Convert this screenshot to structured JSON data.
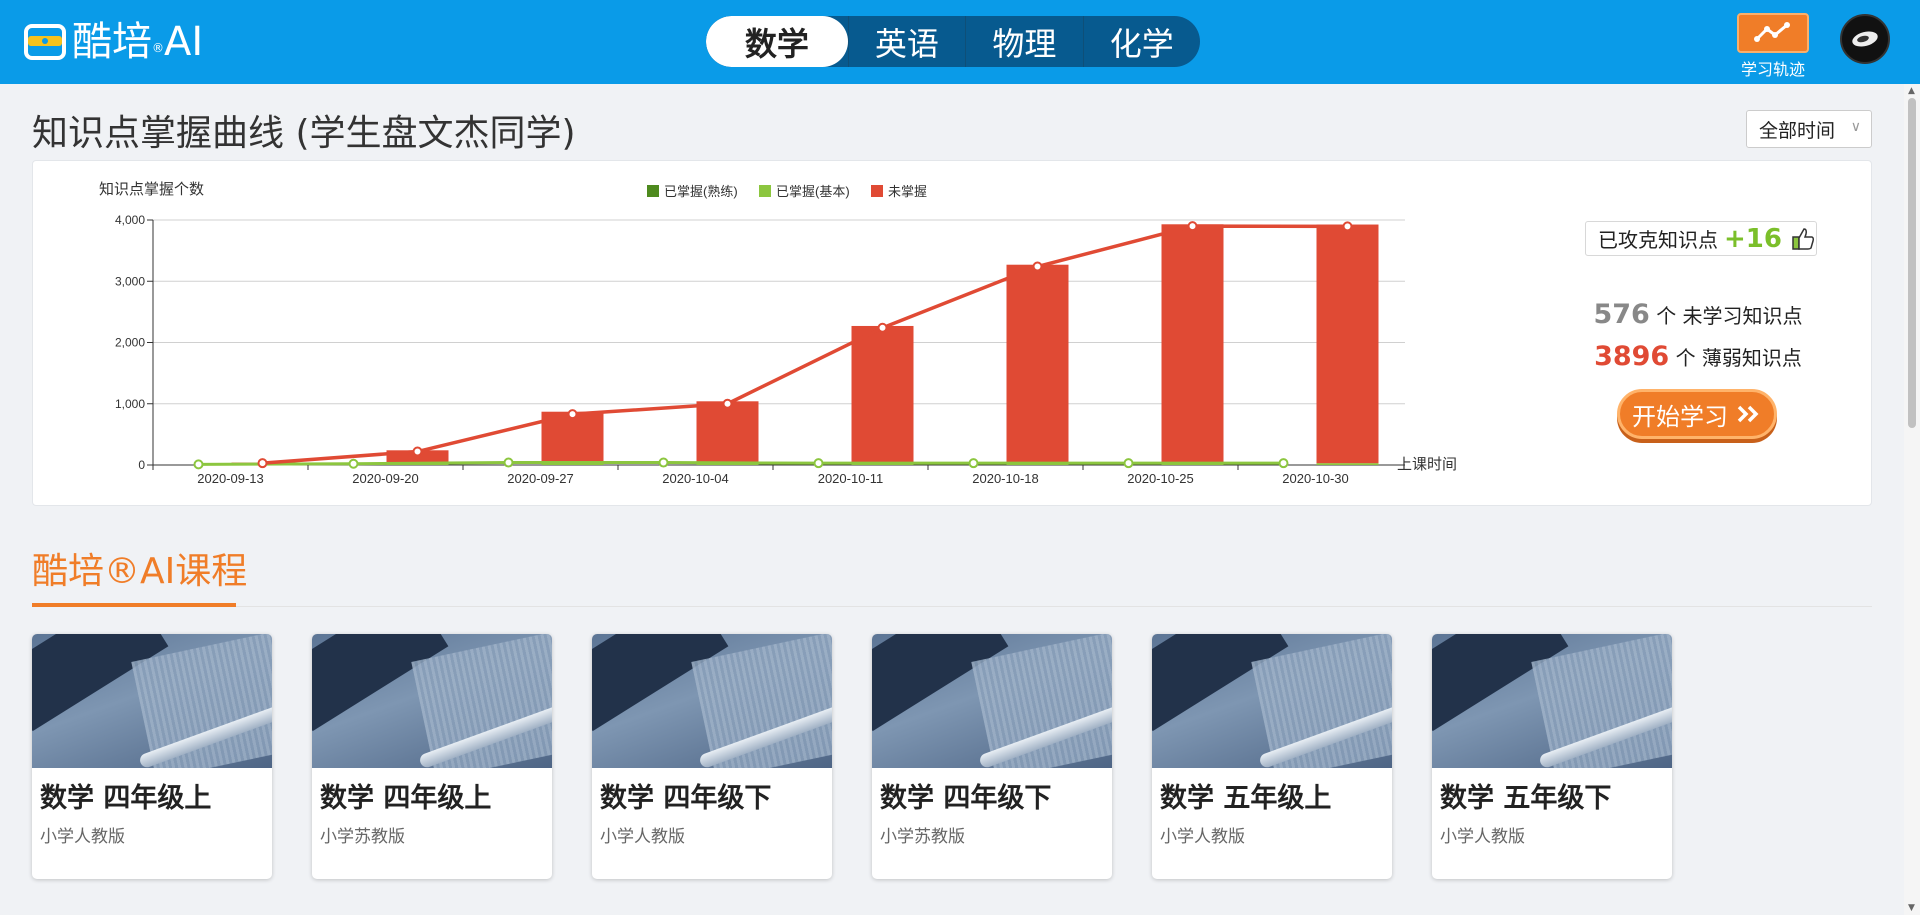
{
  "header": {
    "logo_text": "酷培",
    "logo_suffix": "AI",
    "logo_reg": "®",
    "subjects": [
      "数学",
      "英语",
      "物理",
      "化学"
    ],
    "active_subject": "数学",
    "track_label": "学习轨迹"
  },
  "page": {
    "title": "知识点掌握曲线 (学生盘文杰同学)",
    "time_filter": "全部时间"
  },
  "stats": {
    "conquered_label": "已攻克知识点",
    "conquered_delta": "+16",
    "unlearned_count": "576",
    "unlearned_label": "个 未学习知识点",
    "weak_count": "3896",
    "weak_label": "个 薄弱知识点",
    "start_button": "开始学习"
  },
  "chart_data": {
    "type": "bar",
    "ylabel": "知识点掌握个数",
    "xlabel": "上课时间",
    "ylim": [
      0,
      4000
    ],
    "yticks": [
      "0",
      "1,000",
      "2,000",
      "3,000",
      "4,000"
    ],
    "categories": [
      "2020-09-13",
      "2020-09-20",
      "2020-09-27",
      "2020-10-04",
      "2020-10-11",
      "2020-10-18",
      "2020-10-25",
      "2020-10-30"
    ],
    "legend": [
      "已掌握(熟练)",
      "已掌握(基本)",
      "未掌握"
    ],
    "series": [
      {
        "name": "已掌握(熟练)",
        "color": "#4e8a1e",
        "values": [
          0,
          0,
          0,
          0,
          0,
          0,
          0,
          0
        ]
      },
      {
        "name": "已掌握(基本)",
        "color": "#8cc63f",
        "values": [
          10,
          20,
          40,
          40,
          30,
          30,
          30,
          30
        ]
      },
      {
        "name": "未掌握",
        "color": "#e04a34",
        "values": [
          30,
          220,
          830,
          1000,
          2240,
          3240,
          3900,
          3896
        ]
      }
    ]
  },
  "courses": {
    "section_title": "酷培®AI课程",
    "items": [
      {
        "title": "数学  四年级上",
        "edition": "小学人教版"
      },
      {
        "title": "数学  四年级上",
        "edition": "小学苏教版"
      },
      {
        "title": "数学  四年级下",
        "edition": "小学人教版"
      },
      {
        "title": "数学  四年级下",
        "edition": "小学苏教版"
      },
      {
        "title": "数学  五年级上",
        "edition": "小学人教版"
      },
      {
        "title": "数学  五年级下",
        "edition": "小学人教版"
      }
    ]
  },
  "scroll": {
    "up": "▲",
    "down": "▼"
  }
}
